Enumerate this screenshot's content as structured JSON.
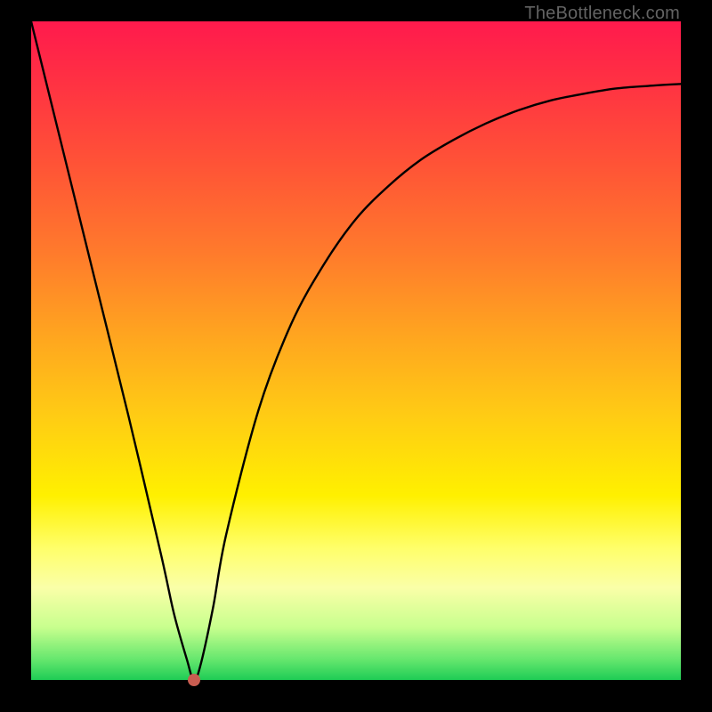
{
  "watermark": "TheBottleneck.com",
  "colors": {
    "frame": "#000000",
    "curve": "#000000",
    "marker": "#c95d51",
    "gradient_stops": [
      "#ff1a4d",
      "#ff2e44",
      "#ff5436",
      "#ff7a2c",
      "#ffa61f",
      "#ffcc14",
      "#fff000",
      "#ffff6a",
      "#faffa8",
      "#c8ff8e",
      "#63e66d",
      "#1ecc55"
    ]
  },
  "chart_data": {
    "type": "line",
    "title": "",
    "xlabel": "",
    "ylabel": "",
    "xlim": [
      0,
      100
    ],
    "ylim": [
      0,
      100
    ],
    "grid": false,
    "legend": false,
    "series": [
      {
        "name": "bottleneck-curve",
        "x": [
          0,
          5,
          10,
          15,
          20,
          22,
          24,
          25,
          26,
          28,
          30,
          35,
          40,
          45,
          50,
          55,
          60,
          65,
          70,
          75,
          80,
          85,
          90,
          95,
          100
        ],
        "y": [
          100,
          80,
          60,
          40,
          19,
          10,
          3,
          0,
          2,
          11,
          22,
          41,
          54,
          63,
          70,
          75,
          79,
          82,
          84.5,
          86.5,
          88,
          89,
          89.8,
          90.2,
          90.5
        ]
      }
    ],
    "annotations": [
      {
        "name": "min-marker",
        "x": 25,
        "y": 0
      }
    ],
    "background": {
      "type": "vertical-gradient",
      "meaning": "red=high bottleneck, green=low bottleneck",
      "stops": [
        {
          "pos": 0.0,
          "color": "#ff1a4d"
        },
        {
          "pos": 0.5,
          "color": "#ffcc14"
        },
        {
          "pos": 0.8,
          "color": "#ffff6a"
        },
        {
          "pos": 1.0,
          "color": "#1ecc55"
        }
      ]
    }
  }
}
